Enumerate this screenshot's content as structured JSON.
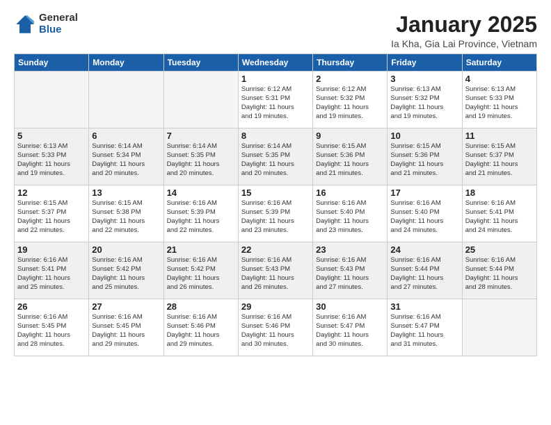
{
  "logo": {
    "general": "General",
    "blue": "Blue"
  },
  "header": {
    "month": "January 2025",
    "location": "Ia Kha, Gia Lai Province, Vietnam"
  },
  "weekdays": [
    "Sunday",
    "Monday",
    "Tuesday",
    "Wednesday",
    "Thursday",
    "Friday",
    "Saturday"
  ],
  "weeks": [
    [
      {
        "day": "",
        "info": ""
      },
      {
        "day": "",
        "info": ""
      },
      {
        "day": "",
        "info": ""
      },
      {
        "day": "1",
        "info": "Sunrise: 6:12 AM\nSunset: 5:31 PM\nDaylight: 11 hours\nand 19 minutes."
      },
      {
        "day": "2",
        "info": "Sunrise: 6:12 AM\nSunset: 5:32 PM\nDaylight: 11 hours\nand 19 minutes."
      },
      {
        "day": "3",
        "info": "Sunrise: 6:13 AM\nSunset: 5:32 PM\nDaylight: 11 hours\nand 19 minutes."
      },
      {
        "day": "4",
        "info": "Sunrise: 6:13 AM\nSunset: 5:33 PM\nDaylight: 11 hours\nand 19 minutes."
      }
    ],
    [
      {
        "day": "5",
        "info": "Sunrise: 6:13 AM\nSunset: 5:33 PM\nDaylight: 11 hours\nand 19 minutes."
      },
      {
        "day": "6",
        "info": "Sunrise: 6:14 AM\nSunset: 5:34 PM\nDaylight: 11 hours\nand 20 minutes."
      },
      {
        "day": "7",
        "info": "Sunrise: 6:14 AM\nSunset: 5:35 PM\nDaylight: 11 hours\nand 20 minutes."
      },
      {
        "day": "8",
        "info": "Sunrise: 6:14 AM\nSunset: 5:35 PM\nDaylight: 11 hours\nand 20 minutes."
      },
      {
        "day": "9",
        "info": "Sunrise: 6:15 AM\nSunset: 5:36 PM\nDaylight: 11 hours\nand 21 minutes."
      },
      {
        "day": "10",
        "info": "Sunrise: 6:15 AM\nSunset: 5:36 PM\nDaylight: 11 hours\nand 21 minutes."
      },
      {
        "day": "11",
        "info": "Sunrise: 6:15 AM\nSunset: 5:37 PM\nDaylight: 11 hours\nand 21 minutes."
      }
    ],
    [
      {
        "day": "12",
        "info": "Sunrise: 6:15 AM\nSunset: 5:37 PM\nDaylight: 11 hours\nand 22 minutes."
      },
      {
        "day": "13",
        "info": "Sunrise: 6:15 AM\nSunset: 5:38 PM\nDaylight: 11 hours\nand 22 minutes."
      },
      {
        "day": "14",
        "info": "Sunrise: 6:16 AM\nSunset: 5:39 PM\nDaylight: 11 hours\nand 22 minutes."
      },
      {
        "day": "15",
        "info": "Sunrise: 6:16 AM\nSunset: 5:39 PM\nDaylight: 11 hours\nand 23 minutes."
      },
      {
        "day": "16",
        "info": "Sunrise: 6:16 AM\nSunset: 5:40 PM\nDaylight: 11 hours\nand 23 minutes."
      },
      {
        "day": "17",
        "info": "Sunrise: 6:16 AM\nSunset: 5:40 PM\nDaylight: 11 hours\nand 24 minutes."
      },
      {
        "day": "18",
        "info": "Sunrise: 6:16 AM\nSunset: 5:41 PM\nDaylight: 11 hours\nand 24 minutes."
      }
    ],
    [
      {
        "day": "19",
        "info": "Sunrise: 6:16 AM\nSunset: 5:41 PM\nDaylight: 11 hours\nand 25 minutes."
      },
      {
        "day": "20",
        "info": "Sunrise: 6:16 AM\nSunset: 5:42 PM\nDaylight: 11 hours\nand 25 minutes."
      },
      {
        "day": "21",
        "info": "Sunrise: 6:16 AM\nSunset: 5:42 PM\nDaylight: 11 hours\nand 26 minutes."
      },
      {
        "day": "22",
        "info": "Sunrise: 6:16 AM\nSunset: 5:43 PM\nDaylight: 11 hours\nand 26 minutes."
      },
      {
        "day": "23",
        "info": "Sunrise: 6:16 AM\nSunset: 5:43 PM\nDaylight: 11 hours\nand 27 minutes."
      },
      {
        "day": "24",
        "info": "Sunrise: 6:16 AM\nSunset: 5:44 PM\nDaylight: 11 hours\nand 27 minutes."
      },
      {
        "day": "25",
        "info": "Sunrise: 6:16 AM\nSunset: 5:44 PM\nDaylight: 11 hours\nand 28 minutes."
      }
    ],
    [
      {
        "day": "26",
        "info": "Sunrise: 6:16 AM\nSunset: 5:45 PM\nDaylight: 11 hours\nand 28 minutes."
      },
      {
        "day": "27",
        "info": "Sunrise: 6:16 AM\nSunset: 5:45 PM\nDaylight: 11 hours\nand 29 minutes."
      },
      {
        "day": "28",
        "info": "Sunrise: 6:16 AM\nSunset: 5:46 PM\nDaylight: 11 hours\nand 29 minutes."
      },
      {
        "day": "29",
        "info": "Sunrise: 6:16 AM\nSunset: 5:46 PM\nDaylight: 11 hours\nand 30 minutes."
      },
      {
        "day": "30",
        "info": "Sunrise: 6:16 AM\nSunset: 5:47 PM\nDaylight: 11 hours\nand 30 minutes."
      },
      {
        "day": "31",
        "info": "Sunrise: 6:16 AM\nSunset: 5:47 PM\nDaylight: 11 hours\nand 31 minutes."
      },
      {
        "day": "",
        "info": ""
      }
    ]
  ]
}
